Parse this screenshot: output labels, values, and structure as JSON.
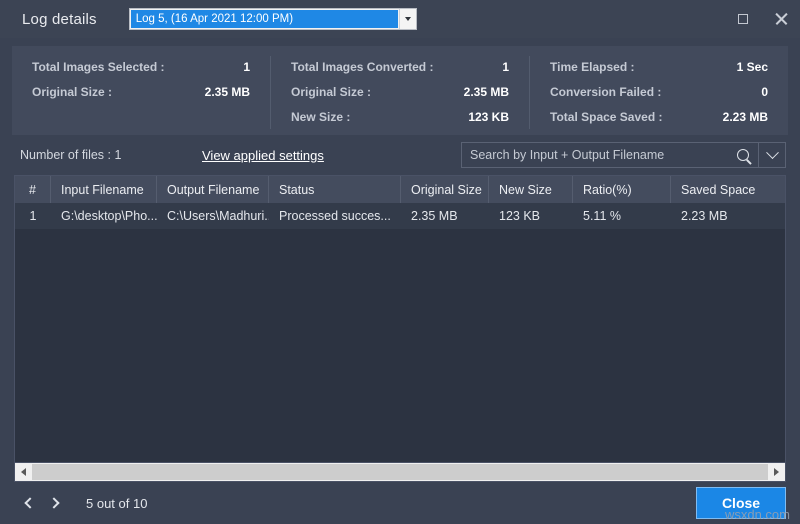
{
  "titlebar": {
    "title": "Log details",
    "log_selector": {
      "selected": "Log 5, (16 Apr 2021 12:00 PM)",
      "caret_icon": "chevron-down-icon"
    },
    "maximize_icon": "maximize-icon",
    "close_icon": "close-icon"
  },
  "stats": {
    "columns": [
      {
        "rows": [
          {
            "label": "Total Images Selected :",
            "value": "1"
          },
          {
            "label": "Original Size :",
            "value": "2.35 MB"
          }
        ]
      },
      {
        "rows": [
          {
            "label": "Total Images Converted :",
            "value": "1"
          },
          {
            "label": "Original Size :",
            "value": "2.35 MB"
          },
          {
            "label": "New Size :",
            "value": "123 KB"
          }
        ]
      },
      {
        "rows": [
          {
            "label": "Time Elapsed :",
            "value": "1 Sec"
          },
          {
            "label": "Conversion Failed :",
            "value": "0"
          },
          {
            "label": "Total Space Saved :",
            "value": "2.23 MB"
          }
        ]
      }
    ]
  },
  "toolbar": {
    "files_count": "Number of files : 1",
    "applied_settings_link": "View applied settings",
    "search": {
      "placeholder": "Search by Input + Output Filename",
      "value": "",
      "search_icon": "search-icon",
      "dropdown_icon": "chevron-down-icon"
    }
  },
  "table": {
    "headers": [
      "#",
      "Input Filename",
      "Output Filename",
      "Status",
      "Original Size",
      "New Size",
      "Ratio(%)",
      "Saved Space"
    ],
    "rows": [
      {
        "index": "1",
        "input_filename": "G:\\desktop\\Pho...",
        "output_filename": "C:\\Users\\Madhuri...",
        "status": "Processed succes...",
        "original_size": "2.35 MB",
        "new_size": "123 KB",
        "ratio": "5.11 %",
        "saved_space": "2.23 MB"
      }
    ]
  },
  "scrollbar": {
    "left_arrow_icon": "chevron-left-icon",
    "right_arrow_icon": "chevron-right-icon"
  },
  "footer": {
    "prev_icon": "chevron-left-icon",
    "next_icon": "chevron-right-icon",
    "page_status": "5 out of 10",
    "close_label": "Close"
  },
  "watermark": "wsxdn.com",
  "colors": {
    "window_bg": "#3a4253",
    "panel_bg": "#424a5c",
    "table_header_bg": "#444c5e",
    "table_body_bg": "#2c3341",
    "row_bg": "#333b4a",
    "accent_blue": "#1b87e6",
    "combo_blue": "#1f88e5",
    "text_primary": "#e8eaee",
    "text_muted": "#c5cad4"
  }
}
